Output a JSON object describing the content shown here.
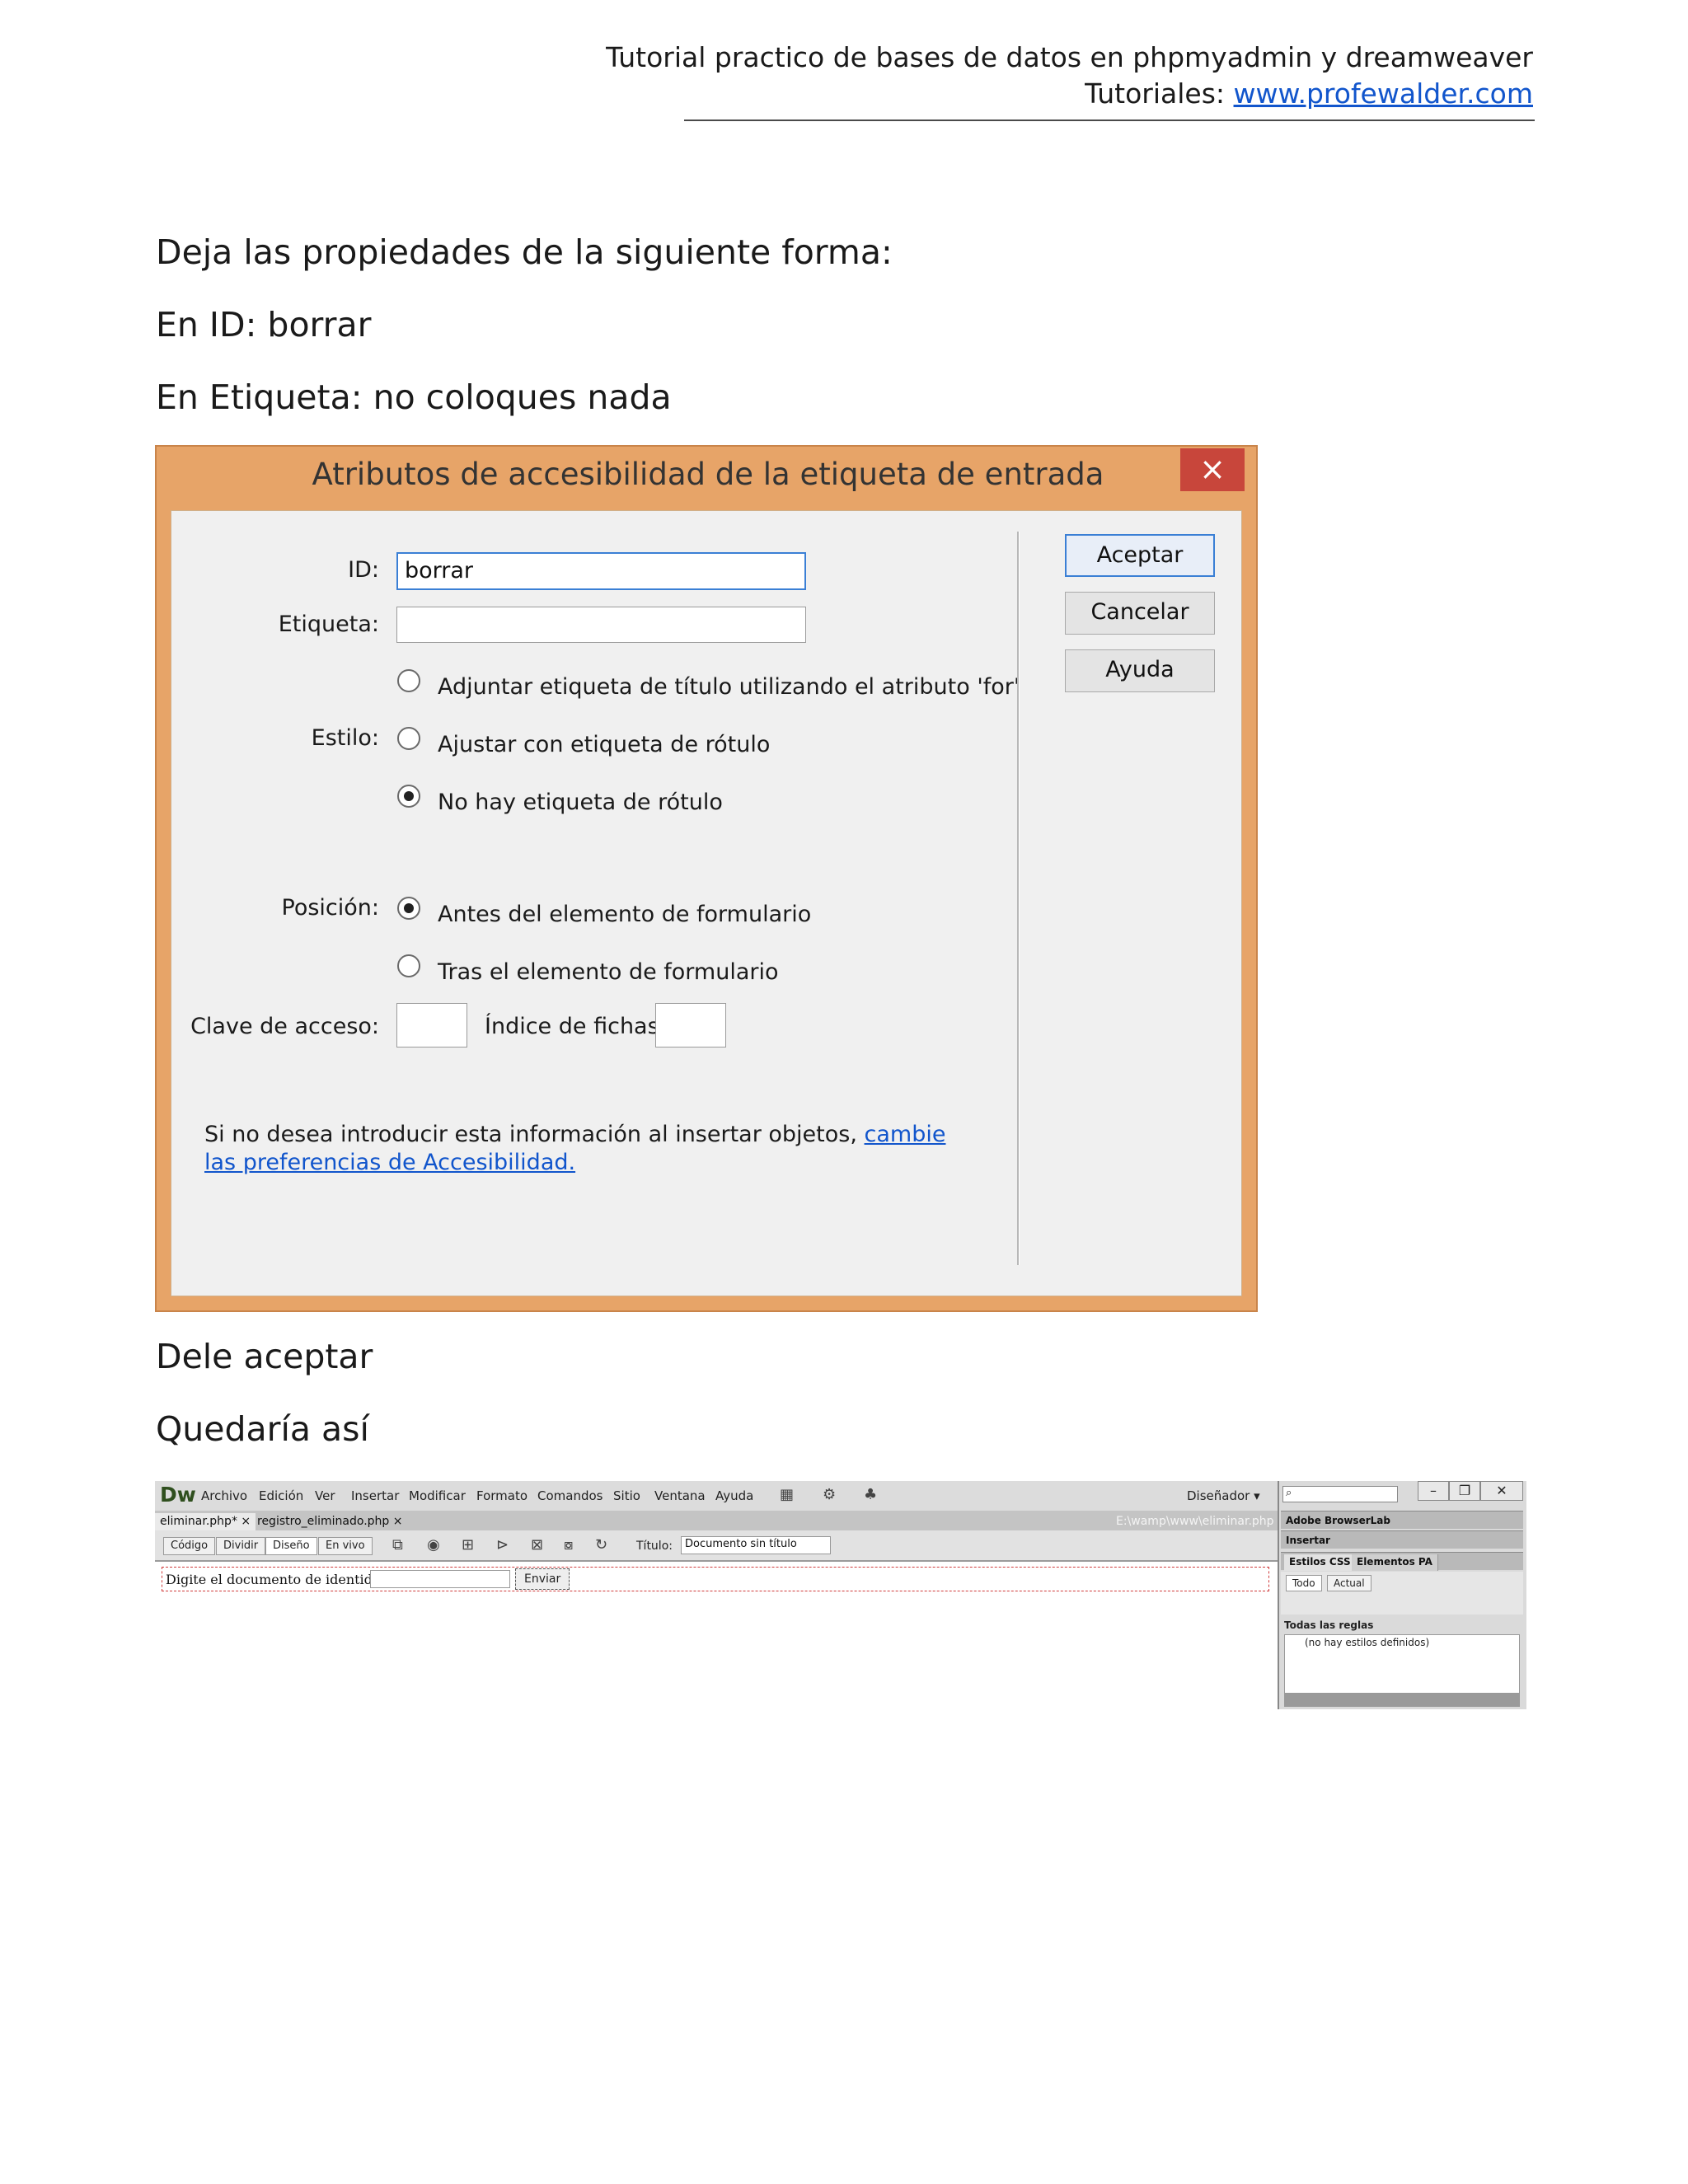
{
  "header": {
    "title": "Tutorial practico de bases de datos en phpmyadmin y dreamweaver",
    "tutorials_label": "Tutoriales:",
    "tutorials_link": "www.profewalder.com"
  },
  "paragraphs": {
    "intro": "Deja las propiedades de la siguiente forma:",
    "id_line": "En ID: borrar",
    "label_line": "En Etiqueta: no coloques nada",
    "accept_line": "Dele aceptar",
    "result_line": "Quedaría así"
  },
  "dialog": {
    "title": "Atributos de accesibilidad de la etiqueta de entrada",
    "close": "×",
    "id_label": "ID:",
    "id_value": "borrar",
    "etiqueta_label": "Etiqueta:",
    "etiqueta_value": "",
    "estilo_label": "Estilo:",
    "estilo_options": [
      "Adjuntar etiqueta de título utilizando el atributo 'for'",
      "Ajustar con etiqueta de rótulo",
      "No hay etiqueta de rótulo"
    ],
    "posicion_label": "Posición:",
    "posicion_options": [
      "Antes del elemento de formulario",
      "Tras el elemento de formulario"
    ],
    "clave_label": "Clave de acceso:",
    "indice_label": "Índice de fichas:",
    "note_text": "Si no desea introducir esta información al insertar objetos,",
    "note_link": "cambie las preferencias de Accesibilidad.",
    "buttons": {
      "ok": "Aceptar",
      "cancel": "Cancelar",
      "help": "Ayuda"
    }
  },
  "dw": {
    "logo": "Dw",
    "menu": [
      "Archivo",
      "Edición",
      "Ver",
      "Insertar",
      "Modificar",
      "Formato",
      "Comandos",
      "Sitio",
      "Ventana",
      "Ayuda"
    ],
    "workspace": "Diseñador ▾",
    "tabs": [
      "eliminar.php* ×",
      "registro_eliminado.php ×"
    ],
    "path": "E:\\wamp\\www\\eliminar.php",
    "views": [
      "Código",
      "Dividir",
      "Diseño",
      "En vivo"
    ],
    "title_label": "Título:",
    "title_value": "Documento sin título",
    "form_label": "Digite el documento de identidad:",
    "form_button": "Enviar",
    "panel": {
      "browserlab": "Adobe BrowserLab",
      "insert": "Insertar",
      "css_tab": "Estilos CSS",
      "ap_tab": "Elementos PA",
      "all_btn": "Todo",
      "current_btn": "Actual",
      "rules_header": "Todas las reglas",
      "rules_empty": "(no hay estilos definidos)"
    }
  }
}
